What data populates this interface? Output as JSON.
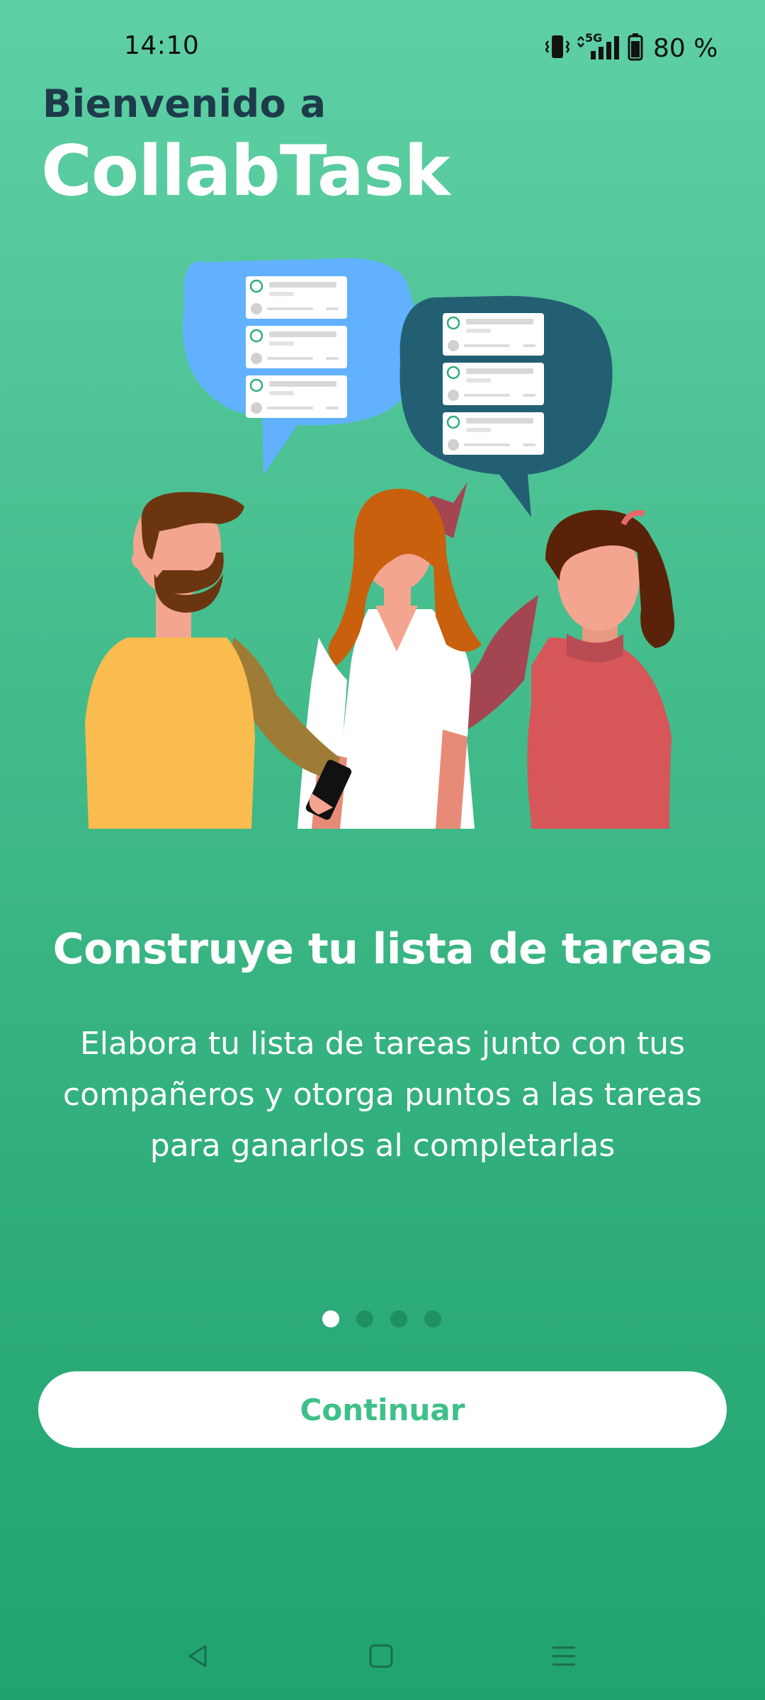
{
  "status_bar": {
    "time": "14:10",
    "network": "5G",
    "battery": "80 %"
  },
  "header": {
    "welcome": "Bienvenido a",
    "app_name": "CollabTask"
  },
  "slide": {
    "title": "Construye tu lista de tareas",
    "description": "Elabora tu lista de tareas junto con tus compañeros y otorga puntos a las tareas para ganarlos al completarlas"
  },
  "pager": {
    "total": 4,
    "active_index": 0
  },
  "actions": {
    "continue_label": "Continuar"
  },
  "colors": {
    "bg_top": "#5fd0a6",
    "bg_bottom": "#21a36f",
    "welcome_text": "#1d3b4a",
    "button_text": "#3fbf8a"
  },
  "icons": {
    "vibrate": "vibrate-icon",
    "signal": "signal-icon",
    "battery": "battery-icon",
    "back": "back-icon",
    "home": "home-icon",
    "recents": "recents-icon"
  }
}
